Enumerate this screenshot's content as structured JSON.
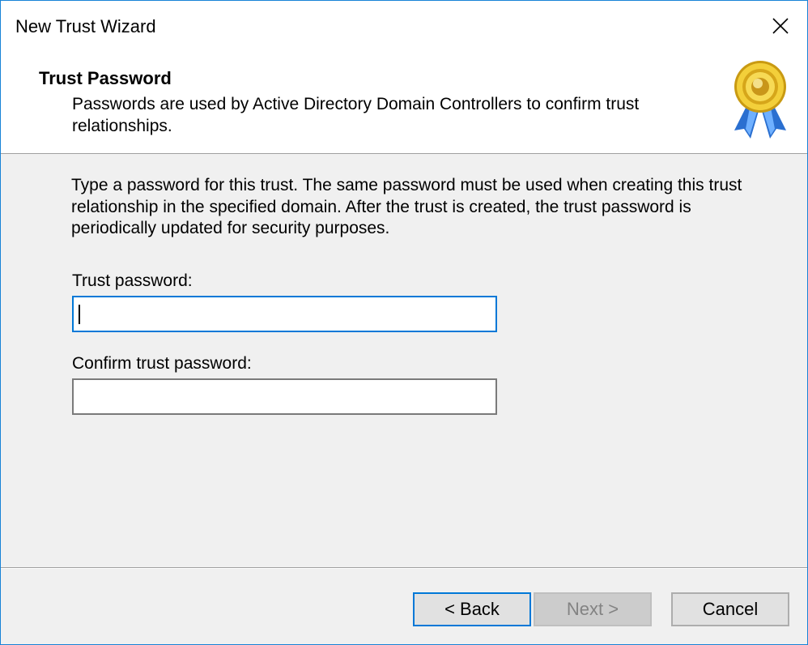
{
  "window": {
    "title": "New Trust Wizard",
    "close_icon": "close-icon"
  },
  "header": {
    "title": "Trust Password",
    "subtitle": "Passwords are used by Active Directory Domain Controllers to confirm trust relationships.",
    "seal_icon": "award-seal-icon"
  },
  "content": {
    "instructions": "Type a password for this trust. The same password must be used when creating this trust relationship in the specified domain. After the trust is created, the trust password is periodically updated for security purposes.",
    "trust_password_label": "Trust password:",
    "trust_password_value": "",
    "confirm_password_label": "Confirm trust password:",
    "confirm_password_value": ""
  },
  "buttons": {
    "back": "< Back",
    "next": "Next >",
    "cancel": "Cancel"
  },
  "colors": {
    "accent": "#0078d7",
    "window_border": "#1883d7",
    "body_background": "#f0f0f0"
  }
}
